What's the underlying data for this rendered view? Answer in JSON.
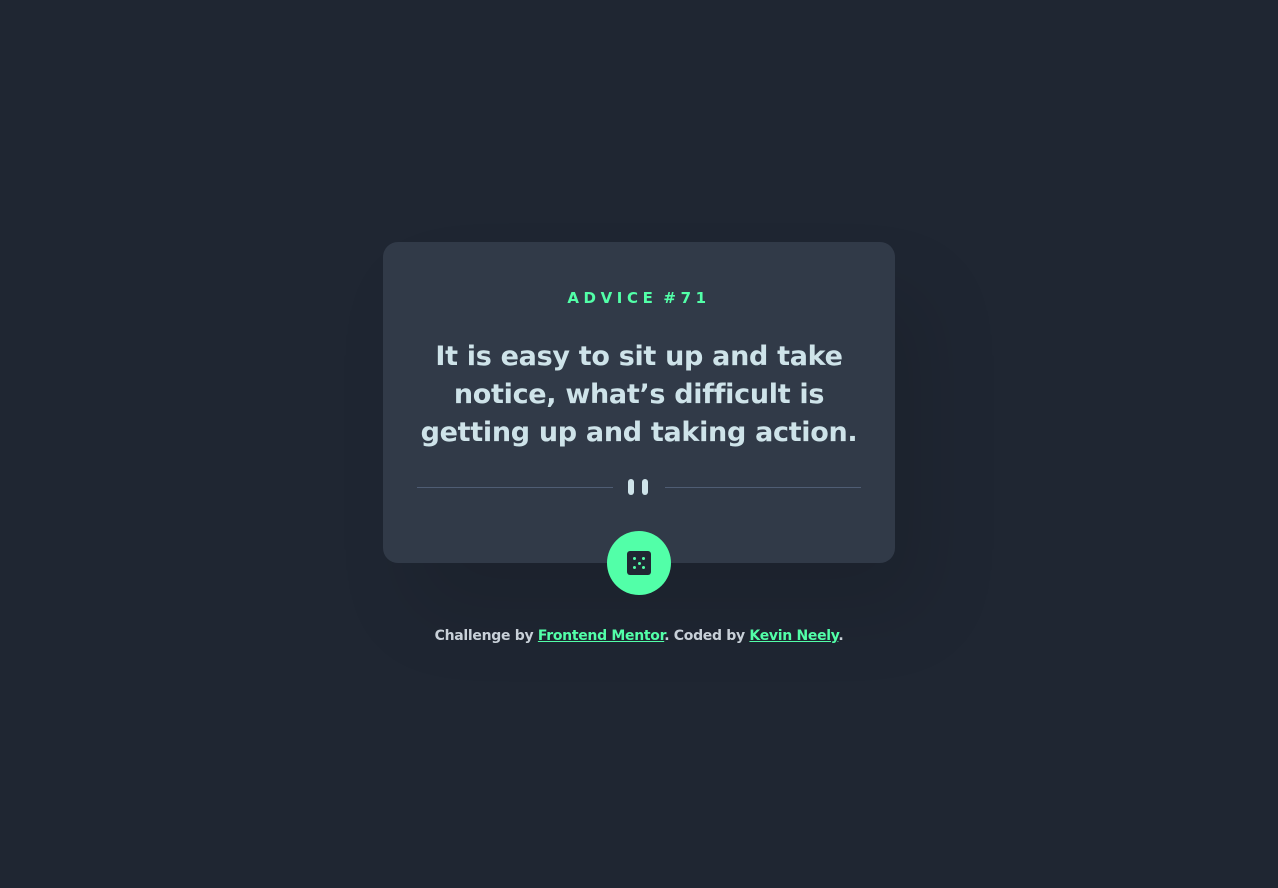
{
  "card": {
    "advice_label": "ADVICE",
    "advice_number": "#71",
    "quote": "It is easy to sit up and take notice, what’s difficult is getting up and taking action."
  },
  "divider": {
    "icon": "pause-icon"
  },
  "dice_button": {
    "icon": "dice-icon"
  },
  "attribution": {
    "prefix": "Challenge by ",
    "link1": "Frontend Mentor",
    "middle": ". Coded by ",
    "link2": "Kevin Neely",
    "suffix": "."
  },
  "colors": {
    "background": "#1f2632",
    "card": "#313a48",
    "accent": "#52ffa8",
    "text": "#cee3e9",
    "divider": "#4f5d74"
  }
}
